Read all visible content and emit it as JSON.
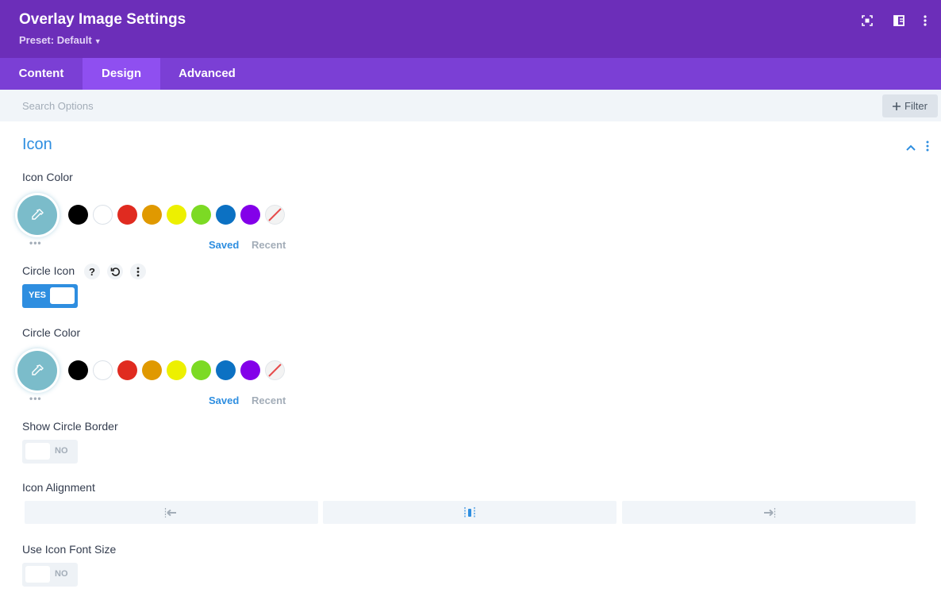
{
  "header": {
    "title": "Overlay Image Settings",
    "preset_label": "Preset: Default",
    "icons": [
      "fullscreen-icon",
      "sidebar-layout-icon",
      "more-vertical-icon"
    ]
  },
  "tabs": [
    {
      "label": "Content",
      "active": false
    },
    {
      "label": "Design",
      "active": true
    },
    {
      "label": "Advanced",
      "active": false
    }
  ],
  "search": {
    "placeholder": "Search Options",
    "value": ""
  },
  "filter": {
    "label": "Filter"
  },
  "section": {
    "title": "Icon"
  },
  "icon_color": {
    "label": "Icon Color",
    "saved_label": "Saved",
    "recent_label": "Recent",
    "swatches": [
      "#000000",
      "#ffffff",
      "#e02b20",
      "#e09900",
      "#edf000",
      "#7cda24",
      "#0c71c3",
      "#8300e9",
      "none"
    ]
  },
  "circle_icon": {
    "label": "Circle Icon",
    "toggle_label": "YES",
    "enabled": true
  },
  "circle_color": {
    "label": "Circle Color",
    "saved_label": "Saved",
    "recent_label": "Recent",
    "swatches": [
      "#000000",
      "#ffffff",
      "#e02b20",
      "#e09900",
      "#edf000",
      "#7cda24",
      "#0c71c3",
      "#8300e9",
      "none"
    ]
  },
  "show_circle_border": {
    "label": "Show Circle Border",
    "toggle_label": "NO",
    "enabled": false
  },
  "icon_alignment": {
    "label": "Icon Alignment",
    "options": [
      "left",
      "center",
      "right"
    ],
    "selected": "center"
  },
  "use_icon_font_size": {
    "label": "Use Icon Font Size",
    "toggle_label": "NO",
    "enabled": false
  },
  "colors": {
    "header_bg": "#6c2eb9",
    "tabs_bg": "#7b3fd5",
    "tab_active_bg": "#8f4ff0",
    "accent": "#2e8ee0",
    "toggle_off_bg": "#eef2f6"
  }
}
